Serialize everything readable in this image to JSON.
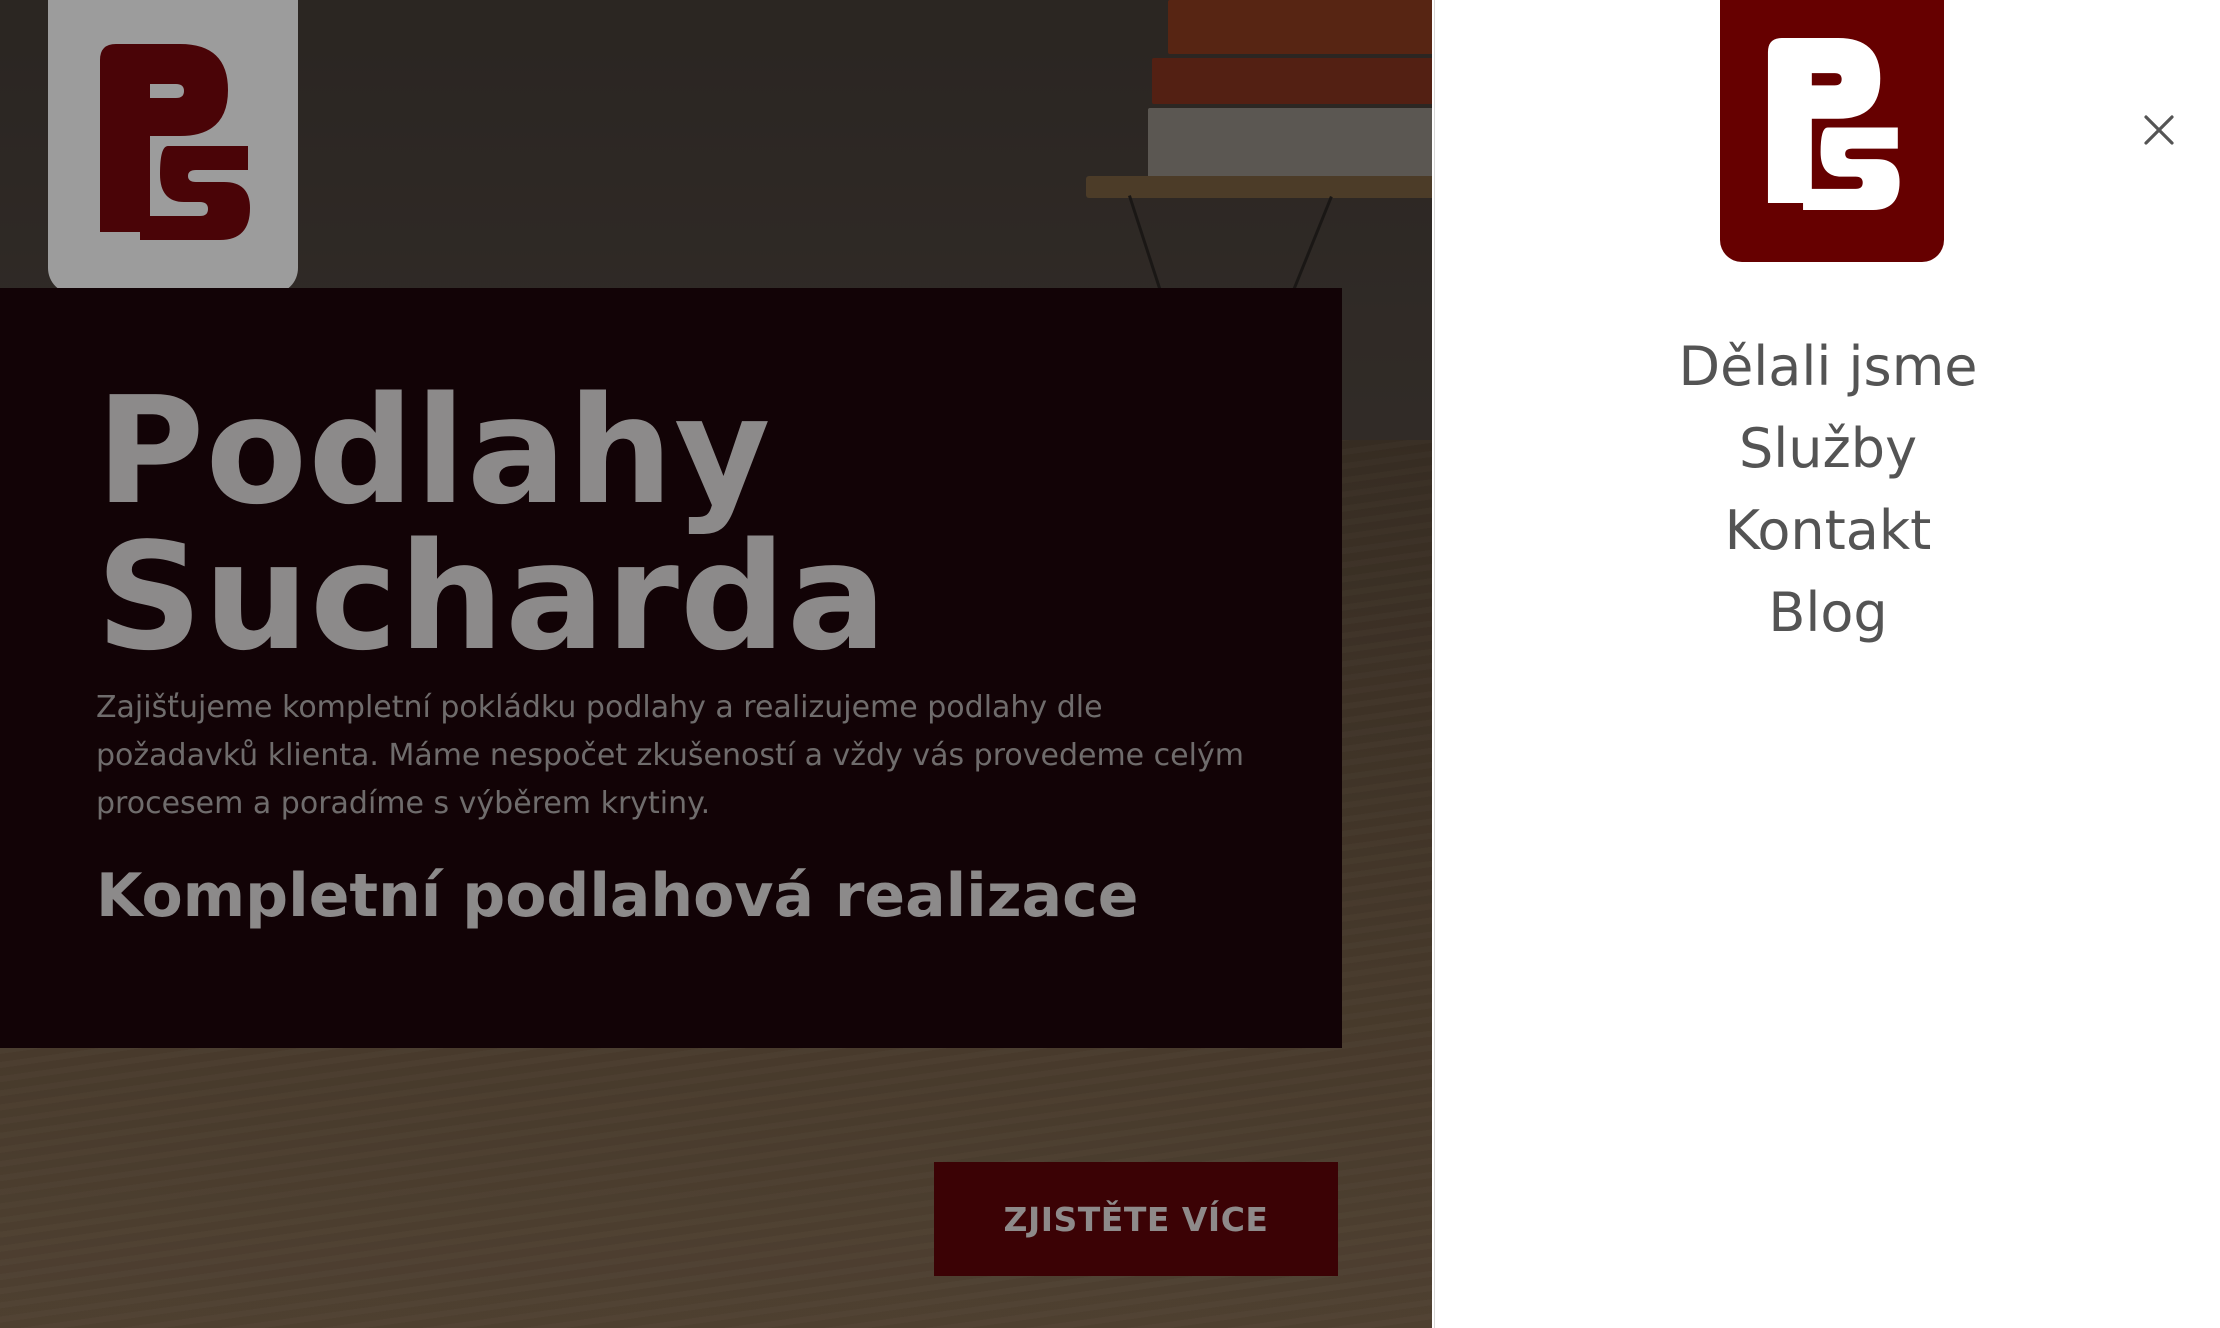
{
  "colors": {
    "brand_maroon": "#660000",
    "hero_panel": "#120306",
    "cta_background": "#3b0205",
    "nav_text": "#545454"
  },
  "hero": {
    "logo_icon": "ps-logo-icon",
    "title_line1": "Podlahy",
    "title_line2": "Sucharda",
    "description": "Zajišťujeme kompletní pokládku podlahy a realizujeme podlahy dle požadavků klienta. Máme nespočet zkušeností a vždy vás provedeme celým procesem a poradíme s výběrem krytiny.",
    "subtitle": "Kompletní podlahová realizace",
    "cta_label": "ZJISTĚTE VÍCE"
  },
  "drawer": {
    "logo_icon": "ps-logo-icon",
    "close_icon": "close-icon",
    "nav_items": [
      {
        "label": "Dělali jsme"
      },
      {
        "label": "Služby"
      },
      {
        "label": "Kontakt"
      },
      {
        "label": "Blog"
      }
    ]
  }
}
